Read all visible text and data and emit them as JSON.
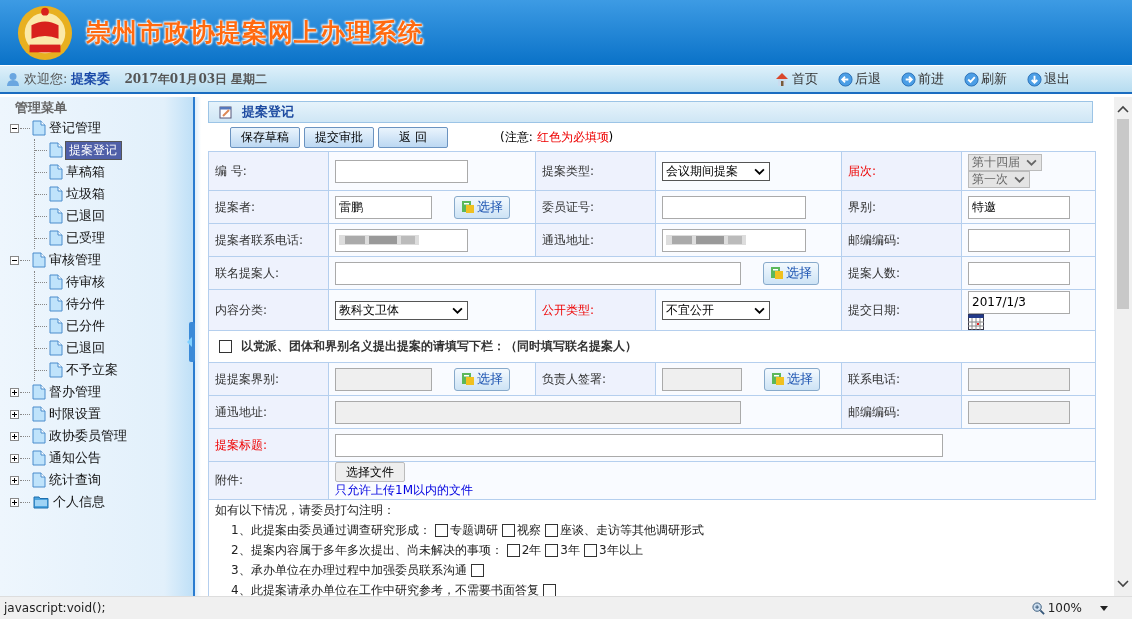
{
  "header": {
    "title": "崇州市政协提案网上办理系统"
  },
  "userbar": {
    "greeting": "欢迎您:",
    "user": "提案委",
    "date": "2017年01月03日 星期二",
    "nav": [
      {
        "label": "首页"
      },
      {
        "label": "后退"
      },
      {
        "label": "前进"
      },
      {
        "label": "刷新"
      },
      {
        "label": "退出"
      }
    ]
  },
  "sidebar": {
    "title": "管理菜单",
    "items": [
      {
        "label": "登记管理",
        "expanded": true,
        "kind": "page",
        "children": [
          {
            "label": "提案登记",
            "selected": true
          },
          {
            "label": "草稿箱",
            "selected": false
          },
          {
            "label": "垃圾箱",
            "selected": false
          },
          {
            "label": "已退回",
            "selected": false
          },
          {
            "label": "已受理",
            "selected": false
          }
        ]
      },
      {
        "label": "审核管理",
        "expanded": true,
        "kind": "page",
        "children": [
          {
            "label": "待审核",
            "selected": false
          },
          {
            "label": "待分件",
            "selected": false
          },
          {
            "label": "已分件",
            "selected": false
          },
          {
            "label": "已退回",
            "selected": false
          },
          {
            "label": "不予立案",
            "selected": false
          }
        ]
      },
      {
        "label": "督办管理",
        "expanded": false,
        "kind": "page"
      },
      {
        "label": "时限设置",
        "expanded": false,
        "kind": "page"
      },
      {
        "label": "政协委员管理",
        "expanded": false,
        "kind": "page"
      },
      {
        "label": "通知公告",
        "expanded": false,
        "kind": "page"
      },
      {
        "label": "统计查询",
        "expanded": false,
        "kind": "page"
      },
      {
        "label": "个人信息",
        "expanded": false,
        "kind": "folder"
      }
    ]
  },
  "panel": {
    "title": "提案登记",
    "buttons": [
      "保存草稿",
      "提交审批",
      "返 回"
    ],
    "note": {
      "prefix": "(注意: ",
      "highlight": "红色为必填项",
      "suffix": ")"
    }
  },
  "form": {
    "rows": [
      {
        "cells": [
          {
            "kind": "label",
            "text": "编 号:",
            "required": false
          },
          {
            "kind": "input",
            "disabled": false
          },
          {
            "kind": "label",
            "text": "提案类型:",
            "required": false
          },
          {
            "kind": "select",
            "value": "会议期间提案"
          },
          {
            "kind": "label",
            "text": "届次:",
            "required": true
          },
          {
            "kind": "select_stack",
            "disabled": true,
            "options": [
              "第十四届",
              "第一次"
            ]
          }
        ]
      },
      {
        "cells": [
          {
            "kind": "label",
            "text": "提案者:",
            "required": false
          },
          {
            "kind": "input_pick",
            "disabled": false,
            "value": "雷鹏",
            "button": "选择"
          },
          {
            "kind": "label",
            "text": "委员证号:",
            "required": false
          },
          {
            "kind": "input",
            "disabled": false
          },
          {
            "kind": "label",
            "text": "界别:",
            "required": false
          },
          {
            "kind": "input",
            "disabled": false,
            "value": "特邀"
          }
        ]
      },
      {
        "cells": [
          {
            "kind": "label",
            "text": "提案者联系电话:",
            "required": false
          },
          {
            "kind": "input",
            "redacted": true
          },
          {
            "kind": "label",
            "text": "通迅地址:",
            "required": false
          },
          {
            "kind": "input",
            "redacted": true
          },
          {
            "kind": "label",
            "text": "邮编编码:",
            "required": false
          },
          {
            "kind": "input",
            "disabled": false
          }
        ]
      },
      {
        "cells": [
          {
            "kind": "label",
            "text": "联名提案人:",
            "required": false
          },
          {
            "kind": "input_pick",
            "disabled": false,
            "button": "选择",
            "colspan": 3
          },
          {
            "kind": "label",
            "text": "提案人数:",
            "required": false
          },
          {
            "kind": "input",
            "disabled": false
          }
        ]
      },
      {
        "cells": [
          {
            "kind": "label",
            "text": "内容分类:",
            "required": false
          },
          {
            "kind": "select",
            "value": "教科文卫体"
          },
          {
            "kind": "label",
            "text": "公开类型:",
            "required": true
          },
          {
            "kind": "select",
            "value": "不宜公开"
          },
          {
            "kind": "label",
            "text": "提交日期:",
            "required": false
          },
          {
            "kind": "date",
            "value": "2017/1/3"
          }
        ]
      },
      {
        "cells": [
          {
            "kind": "checkbox_row",
            "checked": false,
            "colspan": 6,
            "text": "以党派、团体和界别名义提出提案的请填写下栏：（同时填写联名提案人）"
          }
        ]
      },
      {
        "cells": [
          {
            "kind": "label",
            "text": "提提案界别:",
            "required": false
          },
          {
            "kind": "input_pick",
            "disabled": true,
            "button": "选择"
          },
          {
            "kind": "label",
            "text": "负责人签署:",
            "required": false
          },
          {
            "kind": "input_pick",
            "disabled": true,
            "button": "选择"
          },
          {
            "kind": "label",
            "text": "联系电话:",
            "required": false
          },
          {
            "kind": "input",
            "disabled": true
          }
        ]
      },
      {
        "cells": [
          {
            "kind": "label",
            "text": "通迅地址:",
            "required": false
          },
          {
            "kind": "input",
            "disabled": true,
            "colspan": 3
          },
          {
            "kind": "label",
            "text": "邮编编码:",
            "required": false
          },
          {
            "kind": "input",
            "disabled": true
          }
        ]
      },
      {
        "cells": [
          {
            "kind": "label",
            "text": "提案标题:",
            "required": true
          },
          {
            "kind": "input",
            "disabled": false,
            "colspan": 5
          }
        ]
      },
      {
        "cells": [
          {
            "kind": "label",
            "text": "附件:",
            "required": false
          },
          {
            "kind": "file",
            "colspan": 5,
            "button": "选择文件",
            "hint": "只允许上传1M以内的文件"
          }
        ]
      }
    ]
  },
  "notes": {
    "intro": "如有以下情况，请委员打勾注明：",
    "items": [
      {
        "text": "1、此提案由委员通过调查研究形成：",
        "options": [
          {
            "label": "专题调研",
            "checked": false
          },
          {
            "label": "视察",
            "checked": false
          },
          {
            "label": "座谈、走访等其他调研形式",
            "checked": false
          }
        ]
      },
      {
        "text": "2、提案内容属于多年多次提出、尚未解决的事项：",
        "options": [
          {
            "label": "2年",
            "checked": false
          },
          {
            "label": "3年",
            "checked": false
          },
          {
            "label": "3年以上",
            "checked": false
          }
        ]
      },
      {
        "text": "3、承办单位在办理过程中加强委员联系沟通",
        "options": [
          {
            "checked": false
          }
        ]
      },
      {
        "text": "4、此提案请承办单位在工作中研究参考，不需要书面答复",
        "options": [
          {
            "checked": false
          }
        ]
      }
    ]
  },
  "status_bar": {
    "text": "javascript:void();",
    "zoom": "100%"
  }
}
